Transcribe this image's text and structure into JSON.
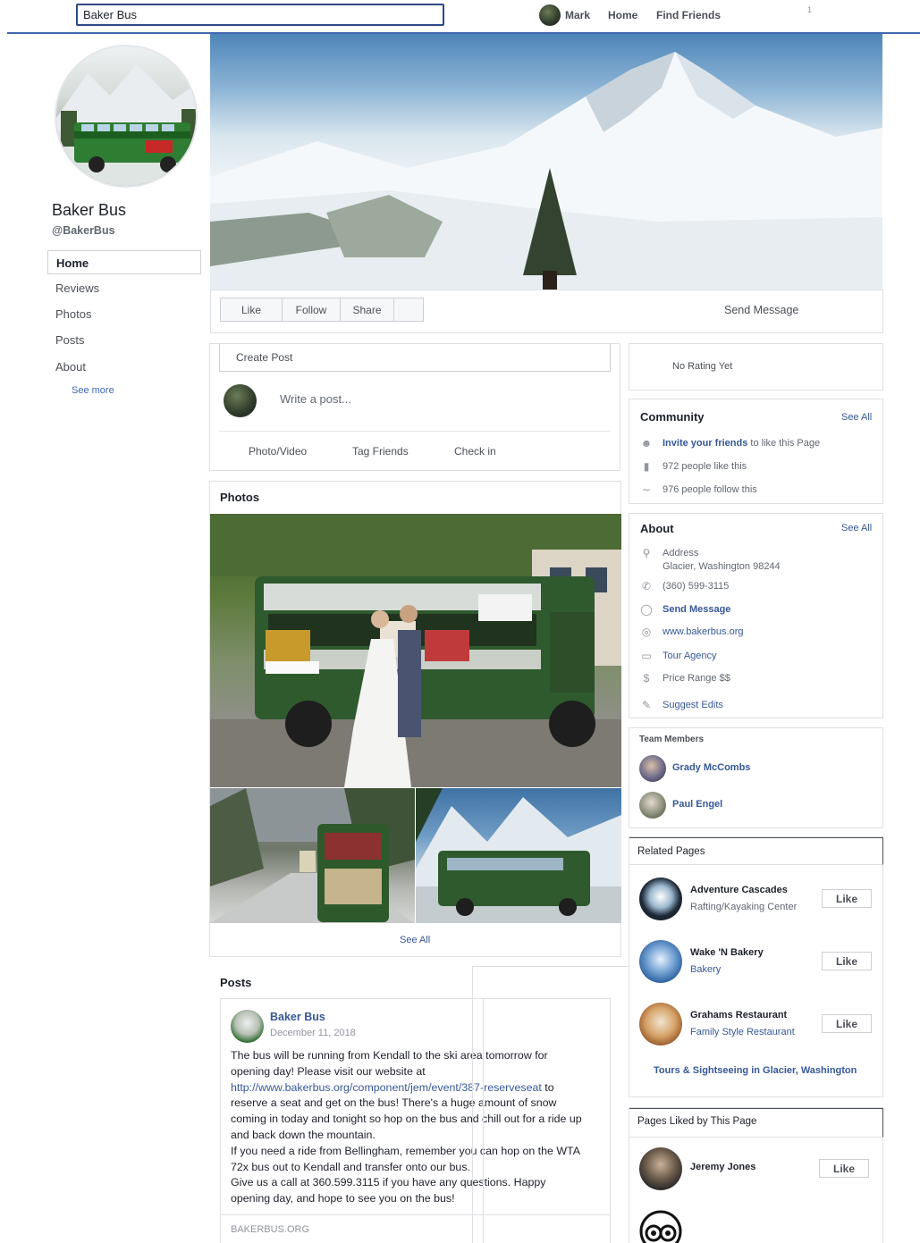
{
  "topbar": {
    "search_value": "Baker Bus",
    "user_name": "Mark",
    "nav_home": "Home",
    "nav_find_friends": "Find Friends",
    "badge_count": "1"
  },
  "profile": {
    "name": "Baker Bus",
    "handle": "@BakerBus"
  },
  "sidebar": {
    "items": [
      {
        "label": "Home",
        "active": true
      },
      {
        "label": "Reviews"
      },
      {
        "label": "Photos"
      },
      {
        "label": "Posts"
      },
      {
        "label": "About"
      }
    ],
    "see_more": "See more"
  },
  "actions": {
    "like": "Like",
    "follow": "Follow",
    "share": "Share",
    "send_message": "Send Message"
  },
  "composer": {
    "title": "Create Post",
    "placeholder": "Write a post...",
    "photo_video": "Photo/Video",
    "tag_friends": "Tag Friends",
    "check_in": "Check in"
  },
  "photos": {
    "title": "Photos",
    "see_all": "See All"
  },
  "posts": {
    "title": "Posts",
    "post": {
      "author": "Baker Bus",
      "date": "December 11, 2018",
      "line1": "The bus will be running from Kendall to the ski area tomorrow for",
      "line2": "opening day! Please visit our website at",
      "link": "http://www.bakerbus.org/component/jem/event/387-reserveseat",
      "link_after": " to",
      "line4": "reserve a seat and get on the bus! There's a huge amount of snow",
      "line5": "coming in today and tonight so hop on the bus and chill out for a ride up",
      "line6": "and back down the mountain.",
      "line7": "If you need a ride from Bellingham, remember you can hop on the WTA",
      "line8": "72x bus out to Kendall and transfer onto our bus.",
      "line9": "Give us a call at 360.599.3115 if you have any questions. Happy",
      "line10": "opening day, and hope to see you on the bus!",
      "link_domain": "BAKERBUS.ORG"
    }
  },
  "rating": {
    "text": "No Rating Yet"
  },
  "community": {
    "title": "Community",
    "see_all": "See All",
    "invite_link": "Invite your friends",
    "invite_rest": " to like this Page",
    "likes": "972 people like this",
    "follows": "976 people follow this"
  },
  "about": {
    "title": "About",
    "see_all": "See All",
    "address_label": "Address",
    "address": "Glacier, Washington 98244",
    "phone": "(360) 599-3115",
    "send_message": "Send Message",
    "website": "www.bakerbus.org",
    "category": "Tour Agency",
    "price_range": "Price Range $$",
    "suggest_edits": "Suggest Edits"
  },
  "team": {
    "title": "Team Members",
    "members": [
      "Grady McCombs",
      "Paul Engel"
    ]
  },
  "related": {
    "title": "Related Pages",
    "pages": [
      {
        "name": "Adventure Cascades",
        "category": "Rafting/Kayaking Center",
        "like": "Like"
      },
      {
        "name": "Wake 'N Bakery",
        "category": "Bakery",
        "like": "Like"
      },
      {
        "name": "Grahams Restaurant",
        "category": "Family Style Restaurant",
        "like": "Like"
      }
    ],
    "footer_link": "Tours & Sightseeing in Glacier, Washington"
  },
  "liked_pages": {
    "title": "Pages Liked by This Page",
    "pages": [
      {
        "name": "Jeremy Jones",
        "like": "Like"
      }
    ]
  },
  "colors": {
    "link": "#365899",
    "topbar_line": "#4267b2",
    "muted": "#616770",
    "border": "#dddfe2"
  }
}
